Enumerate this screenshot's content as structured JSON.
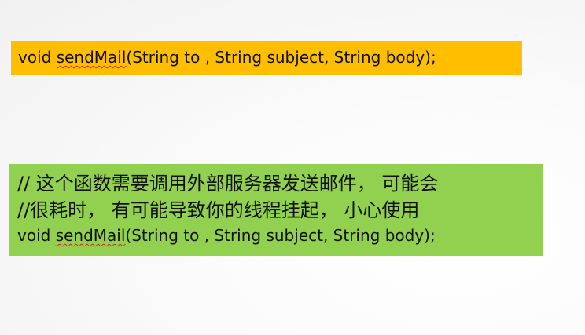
{
  "colors": {
    "top_box": "#ffbe00",
    "bottom_box": "#92d050"
  },
  "top_box": {
    "prefix": "void ",
    "misspelled": "sendMail",
    "suffix": "(String to , String subject, String body);"
  },
  "bottom_box": {
    "comment_line_1": "// 这个函数需要调用外部服务器发送邮件， 可能会",
    "comment_line_2": "//很耗时， 有可能导致你的线程挂起， 小心使用",
    "code_prefix": "void ",
    "code_misspelled": "sendMail",
    "code_suffix": "(String to , String subject, String body);"
  }
}
